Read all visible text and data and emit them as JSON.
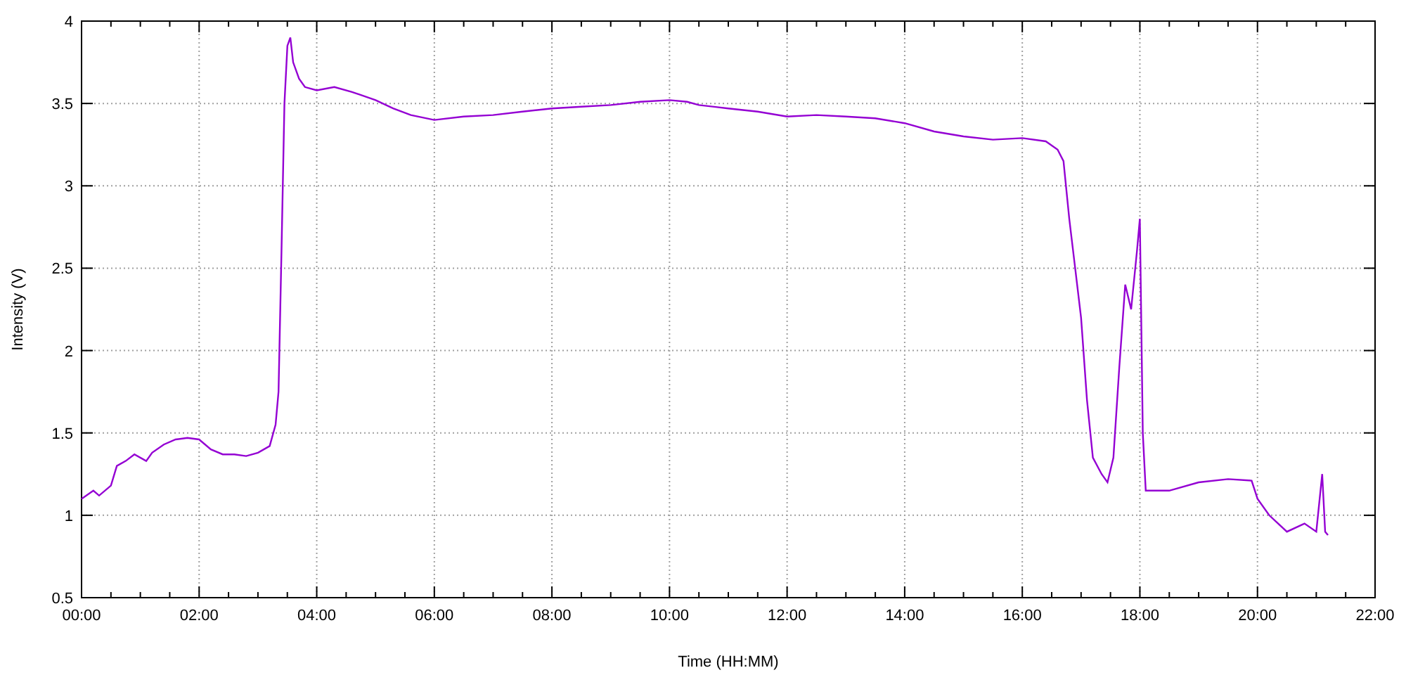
{
  "chart": {
    "chart_data": {
      "type": "line",
      "grid": true,
      "xlabel": "Time (HH:MM)",
      "ylabel": "Intensity (V)",
      "xlim": [
        0,
        22
      ],
      "ylim": [
        0.5,
        4
      ],
      "xticks": [
        {
          "value": 0,
          "label": "00:00"
        },
        {
          "value": 2,
          "label": "02:00"
        },
        {
          "value": 4,
          "label": "04:00"
        },
        {
          "value": 6,
          "label": "06:00"
        },
        {
          "value": 8,
          "label": "08:00"
        },
        {
          "value": 10,
          "label": "10:00"
        },
        {
          "value": 12,
          "label": "12:00"
        },
        {
          "value": 14,
          "label": "14:00"
        },
        {
          "value": 16,
          "label": "16:00"
        },
        {
          "value": 18,
          "label": "18:00"
        },
        {
          "value": 20,
          "label": "20:00"
        },
        {
          "value": 22,
          "label": "22:00"
        }
      ],
      "yticks": [
        0.5,
        1,
        1.5,
        2,
        2.5,
        3,
        3.5,
        4
      ],
      "x": [
        0,
        0.2,
        0.3,
        0.5,
        0.6,
        0.75,
        0.9,
        1.1,
        1.2,
        1.4,
        1.6,
        1.8,
        2.0,
        2.2,
        2.4,
        2.6,
        2.8,
        3.0,
        3.2,
        3.3,
        3.35,
        3.4,
        3.45,
        3.5,
        3.55,
        3.6,
        3.7,
        3.8,
        4.0,
        4.3,
        4.6,
        5.0,
        5.3,
        5.6,
        6.0,
        6.5,
        7.0,
        7.5,
        8.0,
        8.5,
        9.0,
        9.5,
        10.0,
        10.3,
        10.5,
        11.0,
        11.5,
        12.0,
        12.5,
        13.0,
        13.5,
        14.0,
        14.5,
        15.0,
        15.5,
        16.0,
        16.4,
        16.6,
        16.7,
        16.8,
        16.9,
        17.0,
        17.1,
        17.2,
        17.35,
        17.45,
        17.55,
        17.65,
        17.75,
        17.85,
        17.95,
        18.0,
        18.05,
        18.1,
        18.5,
        19.0,
        19.5,
        19.9,
        20.0,
        20.2,
        20.5,
        20.8,
        21.0,
        21.1,
        21.15,
        21.2
      ],
      "series": [
        {
          "color": "#9400d3",
          "values": [
            1.1,
            1.15,
            1.12,
            1.18,
            1.3,
            1.33,
            1.37,
            1.33,
            1.38,
            1.43,
            1.46,
            1.47,
            1.46,
            1.4,
            1.37,
            1.37,
            1.36,
            1.38,
            1.42,
            1.55,
            1.75,
            2.6,
            3.5,
            3.85,
            3.9,
            3.75,
            3.65,
            3.6,
            3.58,
            3.6,
            3.57,
            3.52,
            3.47,
            3.43,
            3.4,
            3.42,
            3.43,
            3.45,
            3.47,
            3.48,
            3.49,
            3.51,
            3.52,
            3.51,
            3.49,
            3.47,
            3.45,
            3.42,
            3.43,
            3.42,
            3.41,
            3.38,
            3.33,
            3.3,
            3.28,
            3.29,
            3.27,
            3.22,
            3.15,
            2.8,
            2.5,
            2.2,
            1.7,
            1.35,
            1.25,
            1.2,
            1.35,
            1.9,
            2.4,
            2.25,
            2.6,
            2.8,
            1.5,
            1.15,
            1.15,
            1.2,
            1.22,
            1.21,
            1.1,
            1.0,
            0.9,
            0.95,
            0.9,
            1.25,
            0.9,
            0.88
          ]
        }
      ]
    }
  }
}
